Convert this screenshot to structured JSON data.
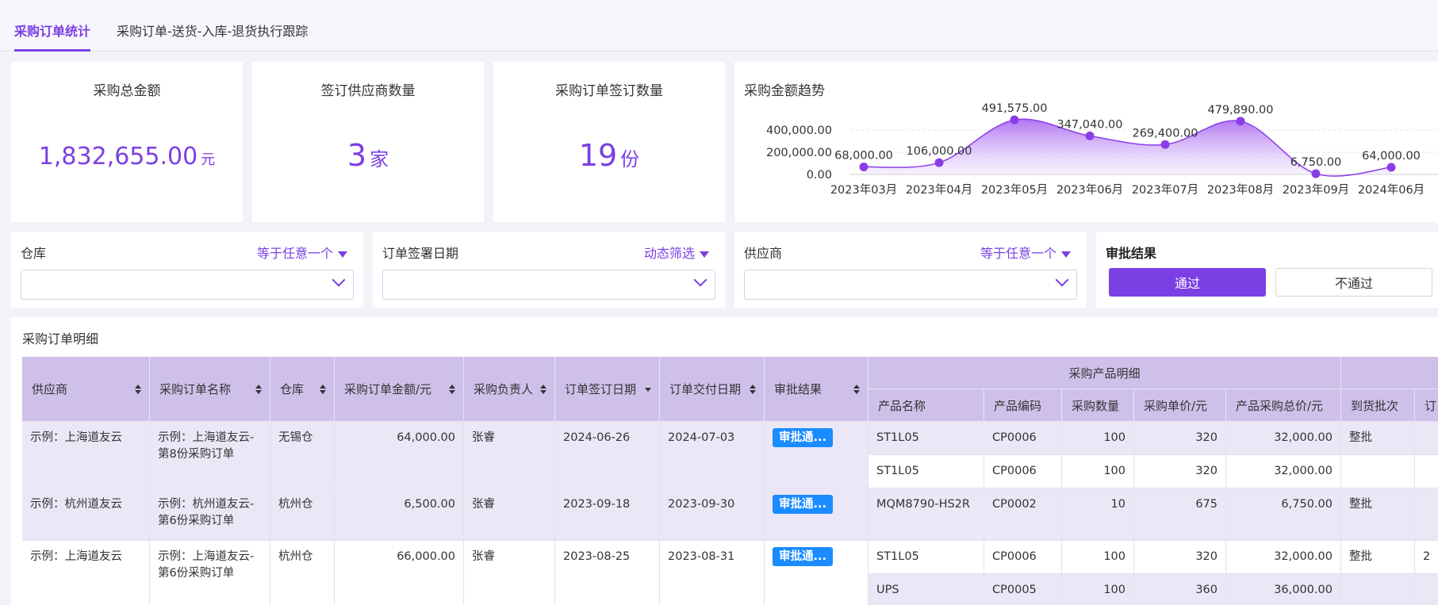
{
  "tabs": [
    {
      "label": "采购订单统计",
      "active": true
    },
    {
      "label": "采购订单-送货-入库-退货执行跟踪",
      "active": false
    }
  ],
  "kpis": {
    "total_amount": {
      "title": "采购总金额",
      "value": "1,832,655.00",
      "unit": "元"
    },
    "supplier_count": {
      "title": "签订供应商数量",
      "value": "3",
      "unit": "家"
    },
    "order_count": {
      "title": "采购订单签订数量",
      "value": "19",
      "unit": "份"
    }
  },
  "trend": {
    "title": "采购金额趋势",
    "accent": "#8a3ee8"
  },
  "chart_data": {
    "type": "area",
    "title": "采购金额趋势",
    "categories": [
      "2023年03月",
      "2023年04月",
      "2023年05月",
      "2023年06月",
      "2023年07月",
      "2023年08月",
      "2023年09月",
      "2024年06月"
    ],
    "values": [
      68000,
      106000,
      491575,
      347040,
      269400,
      479890,
      6750,
      64000
    ],
    "value_labels": [
      "68,000.00",
      "106,000.00",
      "491,575.00",
      "347,040.00",
      "269,400.00",
      "479,890.00",
      "6,750.00",
      "64,000.00"
    ],
    "y_ticks": [
      "0.00",
      "200,000.00",
      "400,000.00"
    ],
    "ylim": [
      0,
      400000
    ],
    "grid": true
  },
  "filters": {
    "warehouse": {
      "label": "仓库",
      "mode": "等于任意一个"
    },
    "sign_date": {
      "label": "订单签署日期",
      "mode": "动态筛选"
    },
    "supplier": {
      "label": "供应商",
      "mode": "等于任意一个"
    },
    "approval": {
      "label": "审批结果",
      "pass_label": "通过",
      "fail_label": "不通过"
    }
  },
  "table": {
    "title": "采购订单明细",
    "group_header": "采购产品明细",
    "columns": [
      "供应商",
      "采购订单名称",
      "仓库",
      "采购订单金额/元",
      "采购负责人",
      "订单签订日期",
      "订单交付日期",
      "审批结果"
    ],
    "sub_columns": [
      "产品名称",
      "产品编码",
      "采购数量",
      "采购单价/元",
      "产品采购总价/元",
      "到货批次"
    ],
    "last_partial_col": "订",
    "rows": [
      {
        "supplier": "示例：上海道友云",
        "order_name": "示例：上海道友云-第8份采购订单",
        "warehouse": "无锡仓",
        "amount": "64,000.00",
        "owner": "张睿",
        "sign_date": "2024-06-26",
        "delivery_date": "2024-07-03",
        "approval": "审批通...",
        "products": [
          {
            "name": "ST1L05",
            "code": "CP0006",
            "qty": "100",
            "price": "320",
            "total": "32,000.00",
            "batch": "整批"
          },
          {
            "name": "ST1L05",
            "code": "CP0006",
            "qty": "100",
            "price": "320",
            "total": "32,000.00",
            "batch": ""
          }
        ]
      },
      {
        "supplier": "示例：杭州道友云",
        "order_name": "示例：杭州道友云-第6份采购订单",
        "warehouse": "杭州仓",
        "amount": "6,500.00",
        "owner": "张睿",
        "sign_date": "2023-09-18",
        "delivery_date": "2023-09-30",
        "approval": "审批通...",
        "products": [
          {
            "name": "MQM8790-HS2R",
            "code": "CP0002",
            "qty": "10",
            "price": "675",
            "total": "6,750.00",
            "batch": "整批"
          }
        ]
      },
      {
        "supplier": "示例：上海道友云",
        "order_name": "示例：上海道友云-第6份采购订单",
        "warehouse": "杭州仓",
        "amount": "66,000.00",
        "owner": "张睿",
        "sign_date": "2023-08-25",
        "delivery_date": "2023-08-31",
        "approval": "审批通...",
        "extra": "2",
        "products": [
          {
            "name": "ST1L05",
            "code": "CP0006",
            "qty": "100",
            "price": "320",
            "total": "32,000.00",
            "batch": "整批"
          },
          {
            "name": "UPS",
            "code": "CP0005",
            "qty": "100",
            "price": "360",
            "total": "36,000.00",
            "batch": ""
          }
        ]
      }
    ]
  }
}
